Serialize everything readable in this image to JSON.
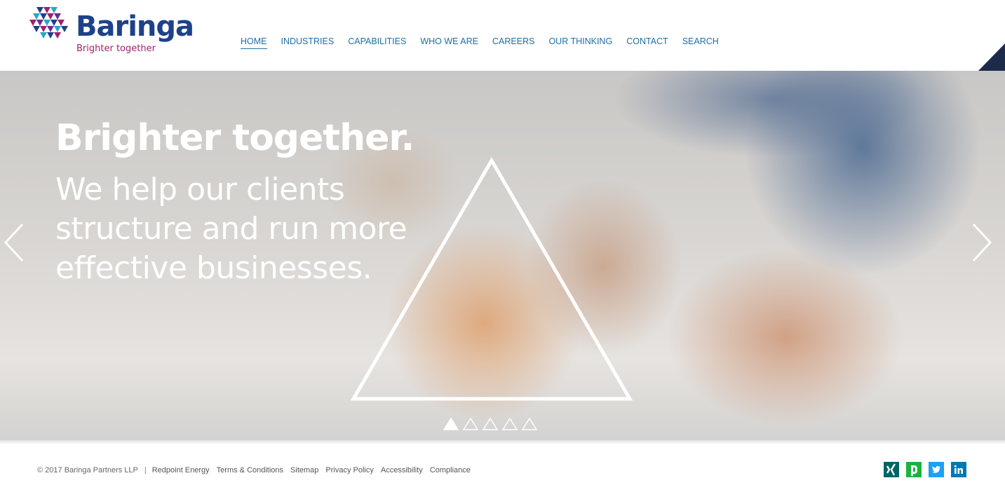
{
  "logo": {
    "wordmark": "Baringa",
    "tagline": "Brighter together",
    "icon": "baringa-triangle-mosaic-logo"
  },
  "nav": {
    "items": [
      {
        "label": "HOME",
        "active": true
      },
      {
        "label": "INDUSTRIES",
        "active": false
      },
      {
        "label": "CAPABILITIES",
        "active": false
      },
      {
        "label": "WHO WE ARE",
        "active": false
      },
      {
        "label": "CAREERS",
        "active": false
      },
      {
        "label": "OUR THINKING",
        "active": false
      },
      {
        "label": "CONTACT",
        "active": false
      },
      {
        "label": "SEARCH",
        "active": false
      }
    ]
  },
  "hero": {
    "title": "Brighter together.",
    "subtitle_lines": [
      "We help our clients",
      "structure and run more",
      "effective businesses."
    ],
    "prev_icon": "chevron-left-icon",
    "next_icon": "chevron-right-icon",
    "slides_total": 5,
    "slide_active": 1
  },
  "footer": {
    "copyright": "© 2017 Baringa Partners LLP",
    "separator": "|",
    "links": [
      "Redpoint Energy",
      "Terms & Conditions",
      "Sitemap",
      "Privacy Policy",
      "Accessibility",
      "Compliance"
    ],
    "social": [
      {
        "name": "xing-icon",
        "color": "#026466"
      },
      {
        "name": "dealogic-icon",
        "color": "#1ab33c"
      },
      {
        "name": "twitter-icon",
        "color": "#1da1f2"
      },
      {
        "name": "linkedin-icon",
        "color": "#0077b5"
      }
    ]
  },
  "colors": {
    "brand_navy": "#1d4289",
    "brand_magenta": "#a3206b",
    "nav_text": "#1d6fa5",
    "fold": "#1d2b4a"
  }
}
